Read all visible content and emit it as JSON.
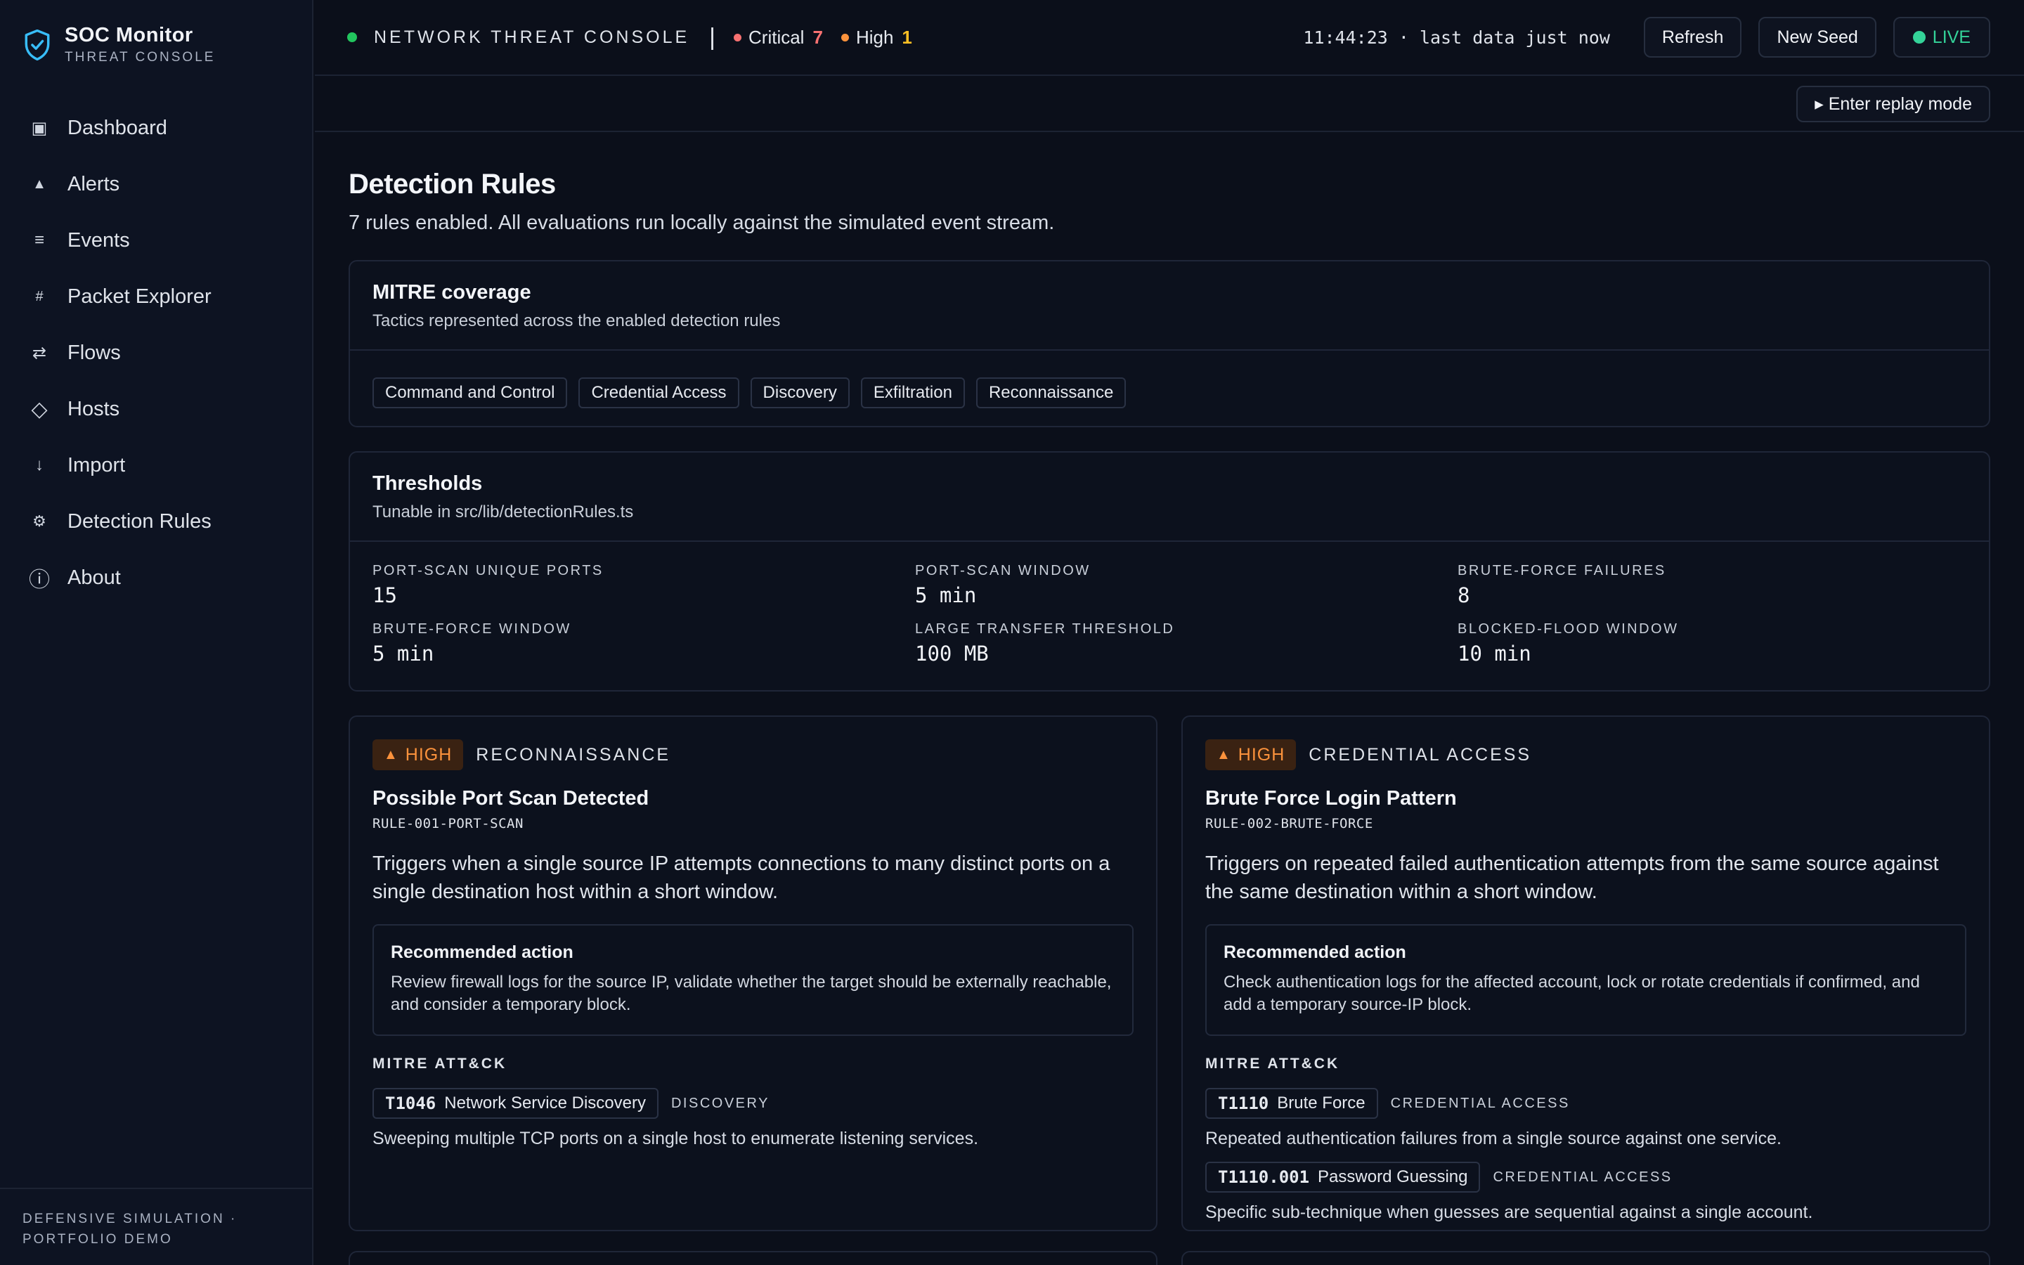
{
  "brand": {
    "name": "SOC Monitor",
    "subtitle": "THREAT CONSOLE"
  },
  "nav": [
    {
      "label": "Dashboard",
      "icon": "square-icon",
      "glyph": "▣"
    },
    {
      "label": "Alerts",
      "icon": "triangle-icon",
      "glyph": "▲"
    },
    {
      "label": "Events",
      "icon": "list-icon",
      "glyph": "≡"
    },
    {
      "label": "Packet Explorer",
      "icon": "hash-icon",
      "glyph": "#"
    },
    {
      "label": "Flows",
      "icon": "arrows-icon",
      "glyph": "⇄"
    },
    {
      "label": "Hosts",
      "icon": "diamond-icon",
      "glyph": "◇"
    },
    {
      "label": "Import",
      "icon": "arrow-down-icon",
      "glyph": "↓"
    },
    {
      "label": "Detection Rules",
      "icon": "gear-icon",
      "glyph": "⚙"
    },
    {
      "label": "About",
      "icon": "info-icon",
      "glyph": "ⓘ"
    }
  ],
  "sidebar_footer": {
    "line1": "DEFENSIVE SIMULATION ·",
    "line2": "PORTFOLIO DEMO"
  },
  "topbar": {
    "title": "NETWORK THREAT CONSOLE",
    "separator": "|",
    "critical_label": "Critical",
    "critical_count": "7",
    "high_label": "High",
    "high_count": "1",
    "clock": "11:44:23 · last data just now",
    "refresh": "Refresh",
    "new_seed": "New Seed",
    "live": "LIVE",
    "replay": "▸ Enter replay mode"
  },
  "colors": {
    "status_green": "#22c55e",
    "critical": "#f87171",
    "high": "#fb923c",
    "live": "#34d399",
    "accent": "#38bdf8"
  },
  "page": {
    "title": "Detection Rules",
    "description": "7 rules enabled. All evaluations run locally against the simulated event stream."
  },
  "mitre_coverage": {
    "title": "MITRE coverage",
    "subtitle": "Tactics represented across the enabled detection rules",
    "tactics": [
      "Command and Control",
      "Credential Access",
      "Discovery",
      "Exfiltration",
      "Reconnaissance"
    ]
  },
  "thresholds": {
    "title": "Thresholds",
    "subtitle": "Tunable in src/lib/detectionRules.ts",
    "items": [
      {
        "label": "PORT-SCAN UNIQUE PORTS",
        "value": "15"
      },
      {
        "label": "PORT-SCAN WINDOW",
        "value": "5 min"
      },
      {
        "label": "BRUTE-FORCE FAILURES",
        "value": "8"
      },
      {
        "label": "BRUTE-FORCE WINDOW",
        "value": "5 min"
      },
      {
        "label": "LARGE TRANSFER THRESHOLD",
        "value": "100 MB"
      },
      {
        "label": "BLOCKED-FLOOD WINDOW",
        "value": "10 min"
      }
    ]
  },
  "rules": [
    {
      "severity": "HIGH",
      "tactic": "RECONNAISSANCE",
      "title": "Possible Port Scan Detected",
      "id": "RULE-001-PORT-SCAN",
      "description": "Triggers when a single source IP attempts connections to many distinct ports on a single destination host within a short window.",
      "rec_title": "Recommended action",
      "rec_text": "Review firewall logs for the source IP, validate whether the target should be externally reachable, and consider a temporary block.",
      "mitre_label": "MITRE ATT&CK",
      "techniques": [
        {
          "id": "T1046",
          "name": "Network Service Discovery",
          "tactic": "DISCOVERY",
          "desc": "Sweeping multiple TCP ports on a single host to enumerate listening services."
        }
      ]
    },
    {
      "severity": "HIGH",
      "tactic": "CREDENTIAL ACCESS",
      "title": "Brute Force Login Pattern",
      "id": "RULE-002-BRUTE-FORCE",
      "description": "Triggers on repeated failed authentication attempts from the same source against the same destination within a short window.",
      "rec_title": "Recommended action",
      "rec_text": "Check authentication logs for the affected account, lock or rotate credentials if confirmed, and add a temporary source-IP block.",
      "mitre_label": "MITRE ATT&CK",
      "techniques": [
        {
          "id": "T1110",
          "name": "Brute Force",
          "tactic": "CREDENTIAL ACCESS",
          "desc": "Repeated authentication failures from a single source against one service."
        },
        {
          "id": "T1110.001",
          "name": "Password Guessing",
          "tactic": "CREDENTIAL ACCESS",
          "desc": "Specific sub-technique when guesses are sequential against a single account."
        }
      ]
    }
  ]
}
